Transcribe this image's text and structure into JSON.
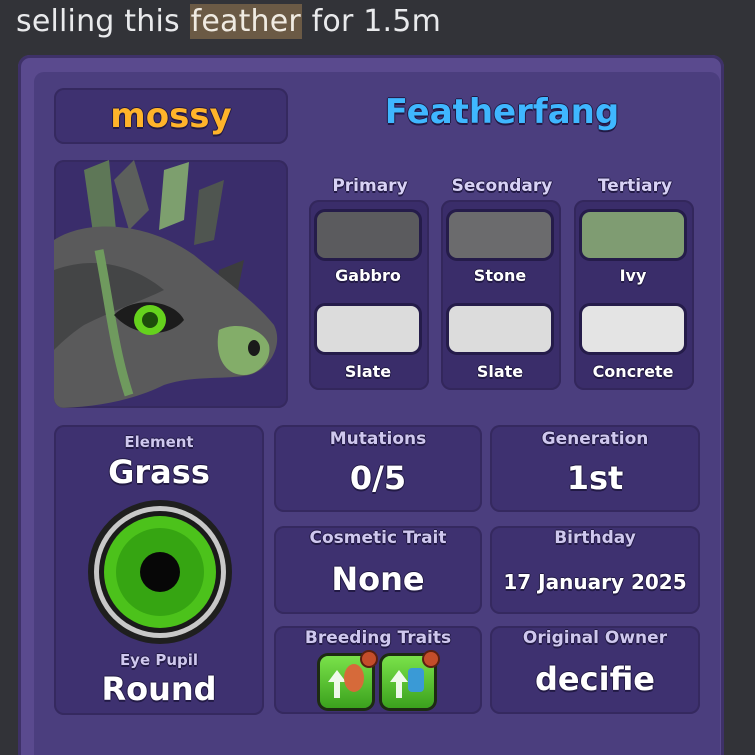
{
  "message": {
    "before": "selling this ",
    "highlight": "feather",
    "after": " for 1.5m"
  },
  "card": {
    "owner_nickname": "mossy",
    "dragon_name": "Featherfang",
    "colors": {
      "columns": [
        {
          "header": "Primary",
          "top": {
            "name": "Gabbro",
            "hex": "#5b5b5e"
          },
          "bottom": {
            "name": "Slate",
            "hex": "#dcdcdc"
          }
        },
        {
          "header": "Secondary",
          "top": {
            "name": "Stone",
            "hex": "#6b6b6d"
          },
          "bottom": {
            "name": "Slate",
            "hex": "#dcdcdc"
          }
        },
        {
          "header": "Tertiary",
          "top": {
            "name": "Ivy",
            "hex": "#7f9c72"
          },
          "bottom": {
            "name": "Concrete",
            "hex": "#e4e4e4"
          }
        }
      ]
    },
    "element": {
      "label": "Element",
      "value": "Grass"
    },
    "eye_pupil": {
      "label": "Eye Pupil",
      "value": "Round"
    },
    "mutations": {
      "label": "Mutations",
      "value": "0/5"
    },
    "generation": {
      "label": "Generation",
      "value": "1st"
    },
    "cosmetic_trait": {
      "label": "Cosmetic Trait",
      "value": "None"
    },
    "birthday": {
      "label": "Birthday",
      "value": "17 January 2025"
    },
    "breeding_traits": {
      "label": "Breeding Traits",
      "icons": [
        "growth-trait-icon",
        "fertility-trait-icon"
      ]
    },
    "original_owner": {
      "label": "Original Owner",
      "value": "decifie"
    }
  },
  "palette": {
    "card_bg": "#4b3e7e",
    "panel_bg": "#3e3170",
    "owner_color": "#ffb42a",
    "name_color": "#3fb7ff",
    "eye_green": "#4cc21b"
  }
}
